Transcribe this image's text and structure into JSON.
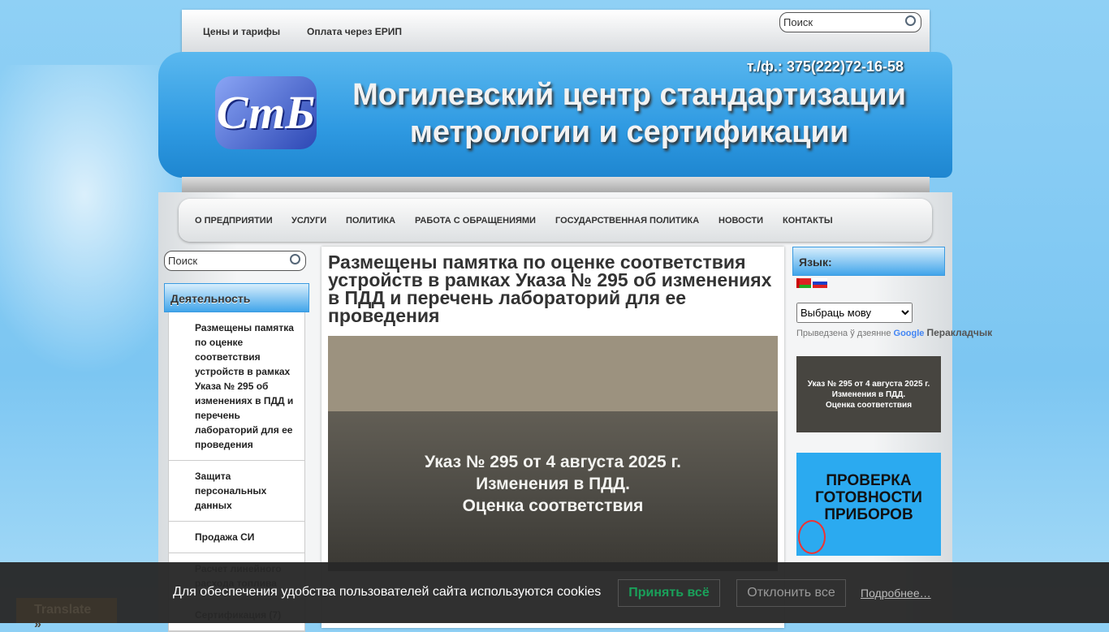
{
  "top": {
    "links": [
      "Цены и тарифы",
      "Оплата через ЕРИП"
    ],
    "search_placeholder": "Поиск"
  },
  "header": {
    "phone": "т./ф.: 375(222)72-16-58",
    "title_line1": "Могилевский центр стандартизации",
    "title_line2": "метрологии и сертификации",
    "logo": "СтБ"
  },
  "nav": [
    "О ПРЕДПРИЯТИИ",
    "УСЛУГИ",
    "ПОЛИТИКА",
    "РАБОТА С ОБРАЩЕНИЯМИ",
    "ГОСУДАРСТВЕННАЯ ПОЛИТИКА",
    "НОВОСТИ",
    "КОНТАКТЫ"
  ],
  "left": {
    "search_placeholder": "Поиск",
    "heading": "Деятельность",
    "items": [
      "Размещены памятка по оценке соответствия устройств в рамках Указа № 295 об изменениях в ПДД и перечень лабораторий для ее проведения",
      "Защита персональных данных",
      "Продажа СИ",
      "Расчет линейного расхода топлива",
      "Сертификация (7)"
    ]
  },
  "main": {
    "title": "Размещены памятка по оценке соответствия устройств в рамках Указа № 295 об изменениях в ПДД и перечень лабораторий для ее проведения",
    "image_text": [
      "Указ № 295 от 4 августа 2025 г.",
      "Изменения в ПДД.",
      "Оценка соответствия"
    ]
  },
  "right": {
    "heading": "Язык:",
    "select": "Выбраць мову",
    "powered": "Прыведзена ў дзеянне",
    "google": "Google",
    "translator": "Перакладчык",
    "banner1": [
      "Указ № 295 от 4 августа 2025 г.",
      "Изменения в ПДД.",
      "Оценка соответствия"
    ],
    "banner2": [
      "ПРОВЕРКА",
      "ГОТОВНОСТИ",
      "ПРИБОРОВ"
    ]
  },
  "cookie": {
    "text": "Для обеспечения удобства пользователей сайта используются cookies",
    "accept": "Принять всё",
    "decline": "Отклонить все",
    "more": "Подробнее…"
  },
  "translate": "Translate »"
}
